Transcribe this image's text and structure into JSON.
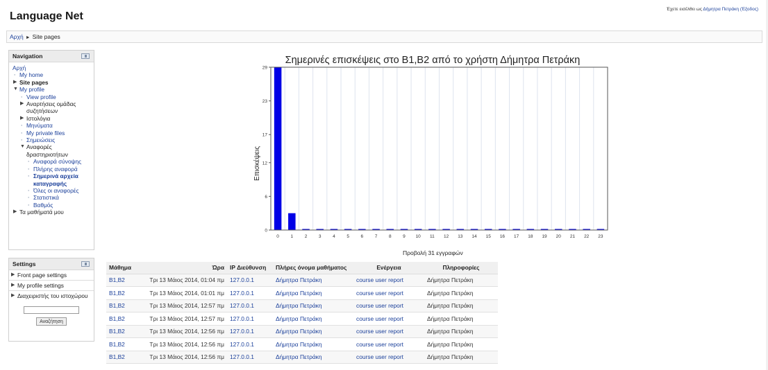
{
  "site": {
    "title": "Language Net",
    "login_prefix": "Έχετε εισέλθει ως ",
    "login_user": "Δήμητρα Πετράκη",
    "login_logout": " (Έξοδος)"
  },
  "breadcrumb": {
    "home": "Αρχή",
    "separator": "►",
    "current": "Site pages"
  },
  "navigation": {
    "title": "Navigation",
    "items": [
      {
        "label": "Αρχή"
      },
      {
        "label": "My home"
      },
      {
        "label": "Site pages"
      },
      {
        "label": "My profile"
      },
      {
        "label": "View profile"
      },
      {
        "label": "Αναρτήσεις ομάδας συζητήσεων"
      },
      {
        "label": "Ιστολόγια"
      },
      {
        "label": "Μηνύματα"
      },
      {
        "label": "My private files"
      },
      {
        "label": "Σημειώσεις"
      },
      {
        "label": "Αναφορές δραστηριοτήτων"
      },
      {
        "label": "Αναφορά σύνοψης"
      },
      {
        "label": "Πλήρης αναφορά"
      },
      {
        "label": "Σημερινά αρχεία καταγραφής"
      },
      {
        "label": "Όλες οι αναφορές"
      },
      {
        "label": "Στατιστικά"
      },
      {
        "label": "Βαθμός"
      },
      {
        "label": "Τα μαθήματά μου"
      }
    ]
  },
  "settings": {
    "title": "Settings",
    "items": [
      {
        "label": "Front page settings"
      },
      {
        "label": "My profile settings"
      },
      {
        "label": "Διαχειριστής του ιστοχώρου"
      }
    ],
    "search_value": "",
    "search_button": "Αναζήτηση"
  },
  "chart_data": {
    "type": "bar",
    "title": "Σημερινές επισκέψεις στο B1,B2 από το χρήστη Δήμητρα Πετράκη",
    "xlabel": "",
    "ylabel": "Επισκέψεις",
    "categories": [
      "0",
      "1",
      "2",
      "3",
      "4",
      "5",
      "6",
      "7",
      "8",
      "9",
      "10",
      "11",
      "12",
      "13",
      "14",
      "15",
      "16",
      "17",
      "18",
      "19",
      "20",
      "21",
      "22",
      "23"
    ],
    "values": [
      29,
      3,
      0,
      0,
      0,
      0,
      0,
      0,
      0,
      0,
      0,
      0,
      0,
      0,
      0,
      0,
      0,
      0,
      0,
      0,
      0,
      0,
      0,
      0
    ],
    "y_ticks": [
      "0",
      "6",
      "12",
      "17",
      "23",
      "29"
    ],
    "ylim": [
      0,
      29
    ],
    "grid": true,
    "bar_color": "#0000e6"
  },
  "records": {
    "label": "Προβολή 31 εγγραφών"
  },
  "log_table": {
    "headers": [
      "Μάθημα",
      "Ώρα",
      "IP Διεύθυνση",
      "Πλήρες όνομα μαθήματος",
      "Ενέργεια",
      "Πληροφορίες"
    ],
    "rows": [
      {
        "course": "B1,B2",
        "time": "Τρι 13 Μάιος 2014, 01:04 πμ",
        "ip": "127.0.0.1",
        "name": "Δήμητρα Πετράκη",
        "action": "course user report",
        "info": "Δήμητρα Πετράκη"
      },
      {
        "course": "B1,B2",
        "time": "Τρι 13 Μάιος 2014, 01:01 πμ",
        "ip": "127.0.0.1",
        "name": "Δήμητρα Πετράκη",
        "action": "course user report",
        "info": "Δήμητρα Πετράκη"
      },
      {
        "course": "B1,B2",
        "time": "Τρι 13 Μάιος 2014, 12:57 πμ",
        "ip": "127.0.0.1",
        "name": "Δήμητρα Πετράκη",
        "action": "course user report",
        "info": "Δήμητρα Πετράκη"
      },
      {
        "course": "B1,B2",
        "time": "Τρι 13 Μάιος 2014, 12:57 πμ",
        "ip": "127.0.0.1",
        "name": "Δήμητρα Πετράκη",
        "action": "course user report",
        "info": "Δήμητρα Πετράκη"
      },
      {
        "course": "B1,B2",
        "time": "Τρι 13 Μάιος 2014, 12:56 πμ",
        "ip": "127.0.0.1",
        "name": "Δήμητρα Πετράκη",
        "action": "course user report",
        "info": "Δήμητρα Πετράκη"
      },
      {
        "course": "B1,B2",
        "time": "Τρι 13 Μάιος 2014, 12:56 πμ",
        "ip": "127.0.0.1",
        "name": "Δήμητρα Πετράκη",
        "action": "course user report",
        "info": "Δήμητρα Πετράκη"
      },
      {
        "course": "B1,B2",
        "time": "Τρι 13 Μάιος 2014, 12:56 πμ",
        "ip": "127.0.0.1",
        "name": "Δήμητρα Πετράκη",
        "action": "course user report",
        "info": "Δήμητρα Πετράκη"
      }
    ]
  }
}
